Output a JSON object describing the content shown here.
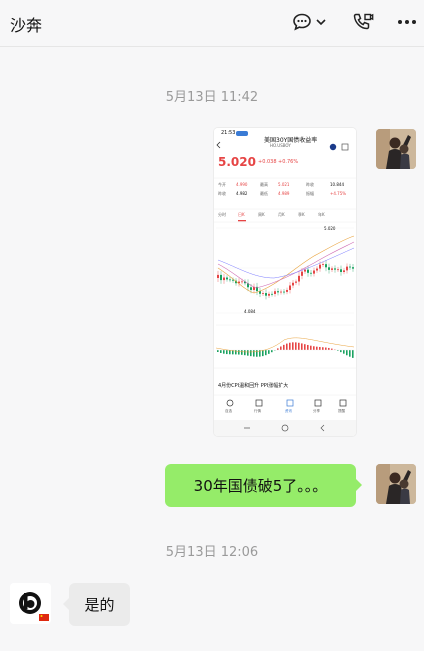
{
  "header": {
    "title": "沙奔",
    "icons": [
      "chat-bubble-icon",
      "chevron-down-icon",
      "phone-video-icon",
      "more-icon"
    ]
  },
  "messages": [
    {
      "type": "timestamp",
      "text": "5月13日 11:42"
    },
    {
      "type": "image",
      "side": "right",
      "screenshot": {
        "status_time": "21:53",
        "name": "美国30Y国债收益率",
        "code": "HO.USBOY",
        "price": "5.020",
        "change": "+0.038",
        "change_pct": "+0.76%",
        "row1": [
          "今开",
          "4.990",
          "最高",
          "5.021",
          "昨收",
          "10.844"
        ],
        "row2": [
          "昨收",
          "4.982",
          "最低",
          "4.989",
          "振幅",
          "+4.75%"
        ],
        "tabs": [
          "分时",
          "日K",
          "周K",
          "月K",
          "季K",
          "年K"
        ],
        "active_tab": "日K",
        "chart_high_label": "5.020",
        "chart_low_label": "4.084",
        "news_title": "4月份CPI温和回升 PPI涨幅扩大",
        "bottom_nav": [
          "自选",
          "行情",
          "资讯",
          "分享",
          "提醒"
        ]
      }
    },
    {
      "type": "text",
      "side": "right",
      "text": "30年国债破5了。。。"
    },
    {
      "type": "timestamp",
      "text": "5月13日 12:06"
    },
    {
      "type": "text",
      "side": "left",
      "text": "是的"
    }
  ],
  "colors": {
    "background": "#f7f7f8",
    "bubble_me": "#95ec69",
    "bubble_other": "#ebebeb",
    "price_up": "#e64545",
    "price_down": "#1aa260"
  }
}
